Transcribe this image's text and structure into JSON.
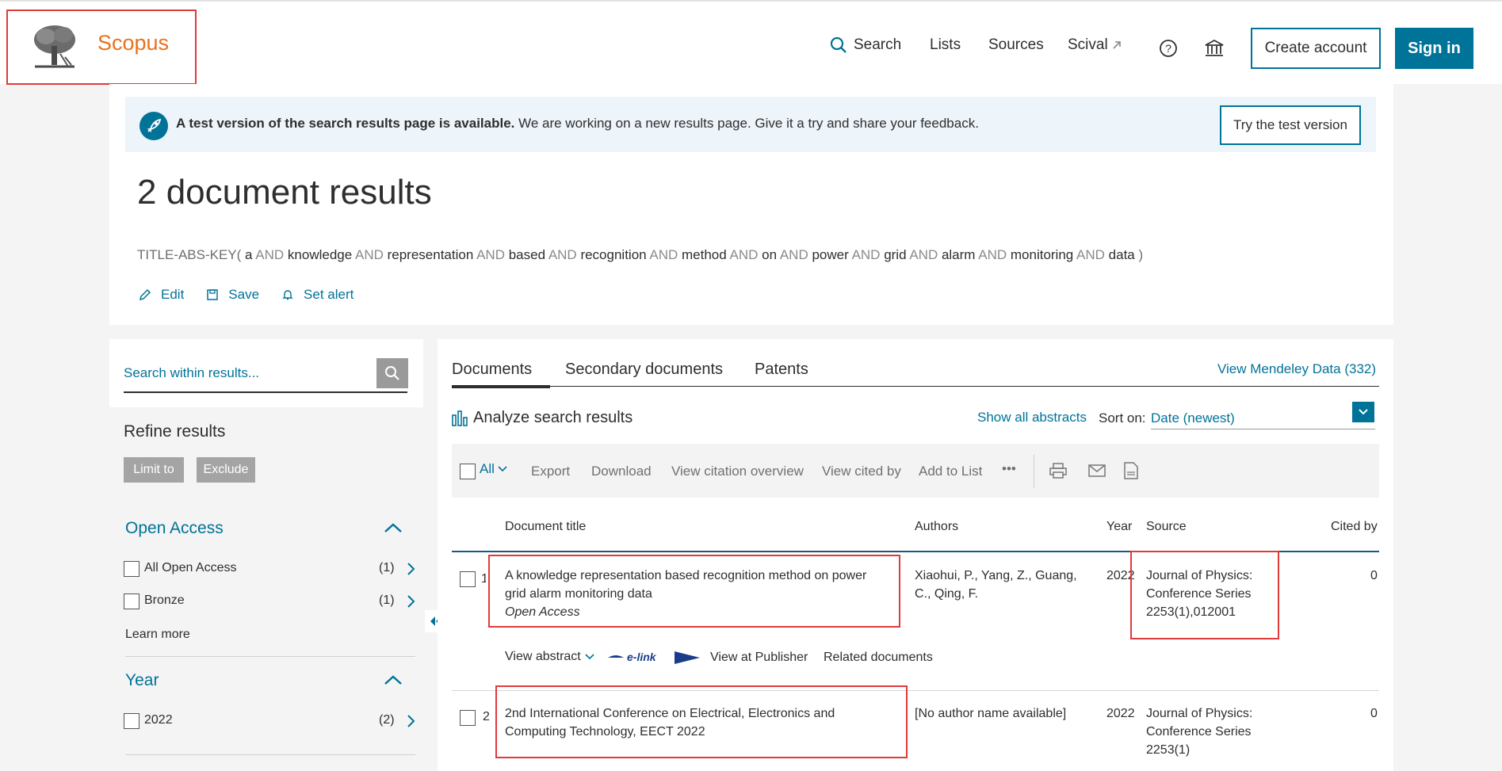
{
  "header": {
    "brand": "Scopus",
    "nav": {
      "search": "Search",
      "lists": "Lists",
      "sources": "Sources",
      "scival": "Scival"
    },
    "create_account": "Create account",
    "sign_in": "Sign in",
    "icons": [
      "search-icon",
      "external-link-icon",
      "help-icon",
      "institution-icon"
    ]
  },
  "banner": {
    "bold": "A test version of the search results page is available.",
    "text": " We are working on a new results page. Give it a try and share your feedback.",
    "button": "Try the test version"
  },
  "results": {
    "title": "2 document results",
    "query_field": "TITLE-ABS-KEY",
    "query_terms": [
      "a",
      "knowledge",
      "representation",
      "based",
      "recognition",
      "method",
      "on",
      "power",
      "grid",
      "alarm",
      "monitoring",
      "data"
    ],
    "query_operator": "AND",
    "actions": {
      "edit": "Edit",
      "save": "Save",
      "set_alert": "Set alert"
    }
  },
  "sidebar": {
    "search_placeholder": "Search within results...",
    "refine_title": "Refine results",
    "limit_to": "Limit to",
    "exclude": "Exclude",
    "open_access": {
      "title": "Open Access",
      "items": [
        {
          "label": "All Open Access",
          "count": "(1)"
        },
        {
          "label": "Bronze",
          "count": "(1)"
        }
      ],
      "learn_more": "Learn more"
    },
    "year": {
      "title": "Year",
      "items": [
        {
          "label": "2022",
          "count": "(2)"
        }
      ]
    }
  },
  "main": {
    "tabs": [
      "Documents",
      "Secondary documents",
      "Patents"
    ],
    "mendeley": "View Mendeley Data (332)",
    "analyze": "Analyze search results",
    "show_abstracts": "Show all abstracts",
    "sort_label": "Sort on:",
    "sort_value": "Date (newest)",
    "toolbar": {
      "all": "All",
      "export": "Export",
      "download": "Download",
      "citation_overview": "View citation overview",
      "cited_by": "View cited by",
      "add_to_list": "Add to List",
      "more": "•••"
    },
    "columns": {
      "title": "Document title",
      "authors": "Authors",
      "year": "Year",
      "source": "Source",
      "cited_by": "Cited by"
    },
    "rows": [
      {
        "num": "1",
        "title_line1": "A knowledge representation based recognition method on power",
        "title_line2": "grid alarm monitoring data",
        "access": "Open Access",
        "authors_line1": "Xiaohui, P., Yang, Z., Guang,",
        "authors_line2": "C., Qing, F.",
        "year": "2022",
        "source_line1": "Journal of Physics:",
        "source_line2": "Conference Series",
        "source_line3": "2253(1),012001",
        "cited": "0",
        "view_abstract": "View abstract",
        "elink": "e-link",
        "view_publisher": "View at Publisher",
        "related": "Related documents"
      },
      {
        "num": "2",
        "title_line1": "2nd International Conference on Electrical, Electronics and",
        "title_line2": "Computing Technology, EECT 2022",
        "authors_line1": "[No author name available]",
        "year": "2022",
        "source_line1": "Journal of Physics:",
        "source_line2": "Conference Series",
        "source_line3": "2253(1)",
        "cited": "0"
      }
    ]
  },
  "colors": {
    "accent": "#007398",
    "brand_orange": "#e9711c",
    "highlight": "#e03a3a"
  }
}
